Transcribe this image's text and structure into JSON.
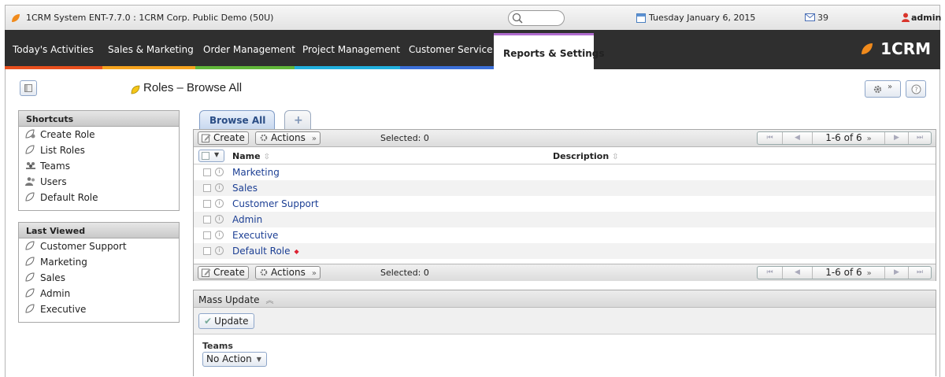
{
  "topbar": {
    "title": "1CRM System ENT-7.7.0 : 1CRM Corp. Public Demo (50U)",
    "date": "Tuesday January 6, 2015",
    "mail_count": "39",
    "user": "admin"
  },
  "nav": {
    "tabs": [
      {
        "label": "Today's Activities",
        "color": "#e8501e"
      },
      {
        "label": "Sales & Marketing",
        "color": "#f5a31e"
      },
      {
        "label": "Order Management",
        "color": "#61b73a"
      },
      {
        "label": "Project Management",
        "color": "#21b0de"
      },
      {
        "label": "Customer Service",
        "color": "#3b6fd8"
      },
      {
        "label": "Reports & Settings",
        "color": "#b06ccf"
      }
    ],
    "brand": "1CRM"
  },
  "page": {
    "title": "Roles – Browse All"
  },
  "sidebar": {
    "shortcuts_title": "Shortcuts",
    "shortcuts": [
      {
        "label": "Create Role",
        "icon": "create-role-icon"
      },
      {
        "label": "List Roles",
        "icon": "role-icon"
      },
      {
        "label": "Teams",
        "icon": "teams-icon"
      },
      {
        "label": "Users",
        "icon": "users-icon"
      },
      {
        "label": "Default Role",
        "icon": "role-icon"
      }
    ],
    "last_viewed_title": "Last Viewed",
    "last_viewed": [
      {
        "label": "Customer Support"
      },
      {
        "label": "Marketing"
      },
      {
        "label": "Sales"
      },
      {
        "label": "Admin"
      },
      {
        "label": "Executive"
      }
    ]
  },
  "list": {
    "tab_label": "Browse All",
    "create_label": "Create",
    "actions_label": "Actions",
    "selected_text": "Selected: 0",
    "pager_text": "1-6 of 6",
    "col_name": "Name",
    "col_description": "Description",
    "rows": [
      {
        "name": "Marketing"
      },
      {
        "name": "Sales"
      },
      {
        "name": "Customer Support"
      },
      {
        "name": "Admin"
      },
      {
        "name": "Executive"
      },
      {
        "name": "Default Role"
      }
    ]
  },
  "mass_update": {
    "title": "Mass Update",
    "update_label": "Update",
    "teams_label": "Teams",
    "teams_value": "No Action"
  }
}
